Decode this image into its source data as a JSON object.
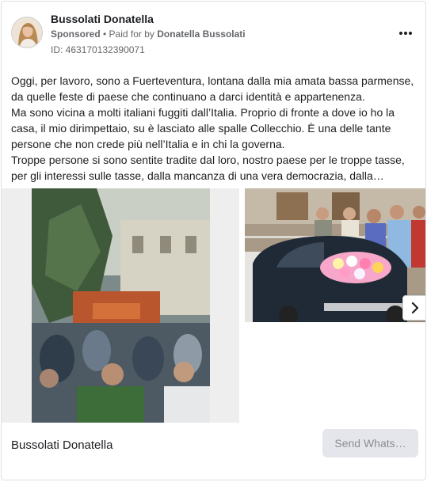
{
  "header": {
    "name": "Bussolati Donatella",
    "sponsored": "Sponsored",
    "separator": " • ",
    "paid_for_by": "Paid for by",
    "payer": "Donatella Bussolati",
    "ad_id": "ID: 463170132390071",
    "more_icon": "more-horizontal-icon"
  },
  "post": {
    "paragraphs": [
      "Oggi, per lavoro, sono a Fuerteventura, lontana dalla mia amata bassa parmense, da quelle feste di paese che continuano a darci identità e appartenenza.",
      "Ma sono vicina a molti italiani fuggiti dall’Italia. Proprio di fronte a dove io ho la casa, il mio dirimpettaio, su è lasciato alle spalle Collecchio. È una delle tante persone che non crede più nell’Italia e in chi la governa.",
      "Troppe persone si sono sentite tradite dal loro, nostro paese per le troppe tasse, per gli interessi sulle tasse, dalla mancanza di una vera democrazia, dalla…"
    ]
  },
  "carousel": {
    "next_icon": "chevron-right-icon"
  },
  "footer": {
    "title": "Bussolati Donatella",
    "cta_label": "Send Whats…"
  }
}
